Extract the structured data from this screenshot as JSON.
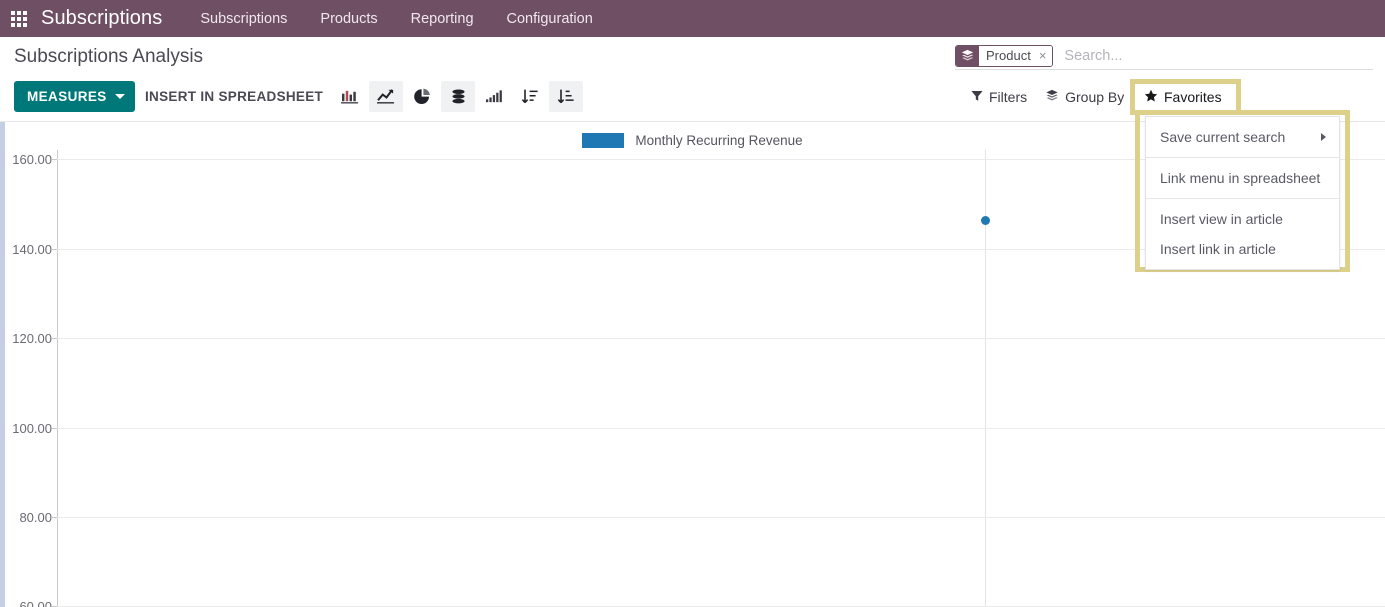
{
  "navbar": {
    "apps_icon": "apps-grid-icon",
    "brand": "Subscriptions",
    "menu": [
      {
        "label": "Subscriptions"
      },
      {
        "label": "Products"
      },
      {
        "label": "Reporting"
      },
      {
        "label": "Configuration"
      }
    ],
    "background_color": "#6f4f63"
  },
  "control_panel": {
    "title": "Subscriptions Analysis",
    "measures_label": "MEASURES",
    "measures_color": "#00787a",
    "insert_in_spreadsheet_label": "INSERT IN SPREADSHEET",
    "view_switcher": [
      {
        "name": "bar-chart-icon",
        "active": false
      },
      {
        "name": "line-chart-icon",
        "active": true
      },
      {
        "name": "pie-chart-icon",
        "active": false
      },
      {
        "name": "stacked-database-icon",
        "active": true
      },
      {
        "name": "ascending-bars-icon",
        "active": false
      },
      {
        "name": "sort-descending-icon",
        "active": false
      },
      {
        "name": "sort-ascending-icon",
        "active": true
      }
    ],
    "filters_label": "Filters",
    "group_by_label": "Group By",
    "favorites_label": "Favorites",
    "highlight_color": "#ddd08a"
  },
  "search": {
    "facet_label": "Product",
    "facet_remove": "×",
    "facet_icon": "layers-icon",
    "placeholder": "Search..."
  },
  "favorites_menu": {
    "items": [
      {
        "label": "Save current search",
        "has_submenu": true
      },
      {
        "label": "Link menu in spreadsheet",
        "has_submenu": false
      },
      {
        "label": "Insert view in article",
        "has_submenu": false
      },
      {
        "label": "Insert link in article",
        "has_submenu": false
      }
    ]
  },
  "chart_data": {
    "type": "line",
    "title": "",
    "xlabel": "",
    "ylabel": "",
    "legend": [
      {
        "name": "Monthly Recurring Revenue",
        "color": "#1f77b4"
      }
    ],
    "legend_position": "top-center",
    "grid": true,
    "ylim": [
      60.0,
      160.0
    ],
    "ytick_labels": [
      "160.00",
      "140.00",
      "120.00",
      "100.00",
      "80.00",
      "60.00"
    ],
    "ytick_values": [
      160.0,
      140.0,
      120.0,
      100.0,
      80.0,
      60.0
    ],
    "x": [
      ""
    ],
    "series": [
      {
        "name": "Monthly Recurring Revenue",
        "color": "#1f77b4",
        "values": [
          148.0
        ]
      }
    ]
  }
}
